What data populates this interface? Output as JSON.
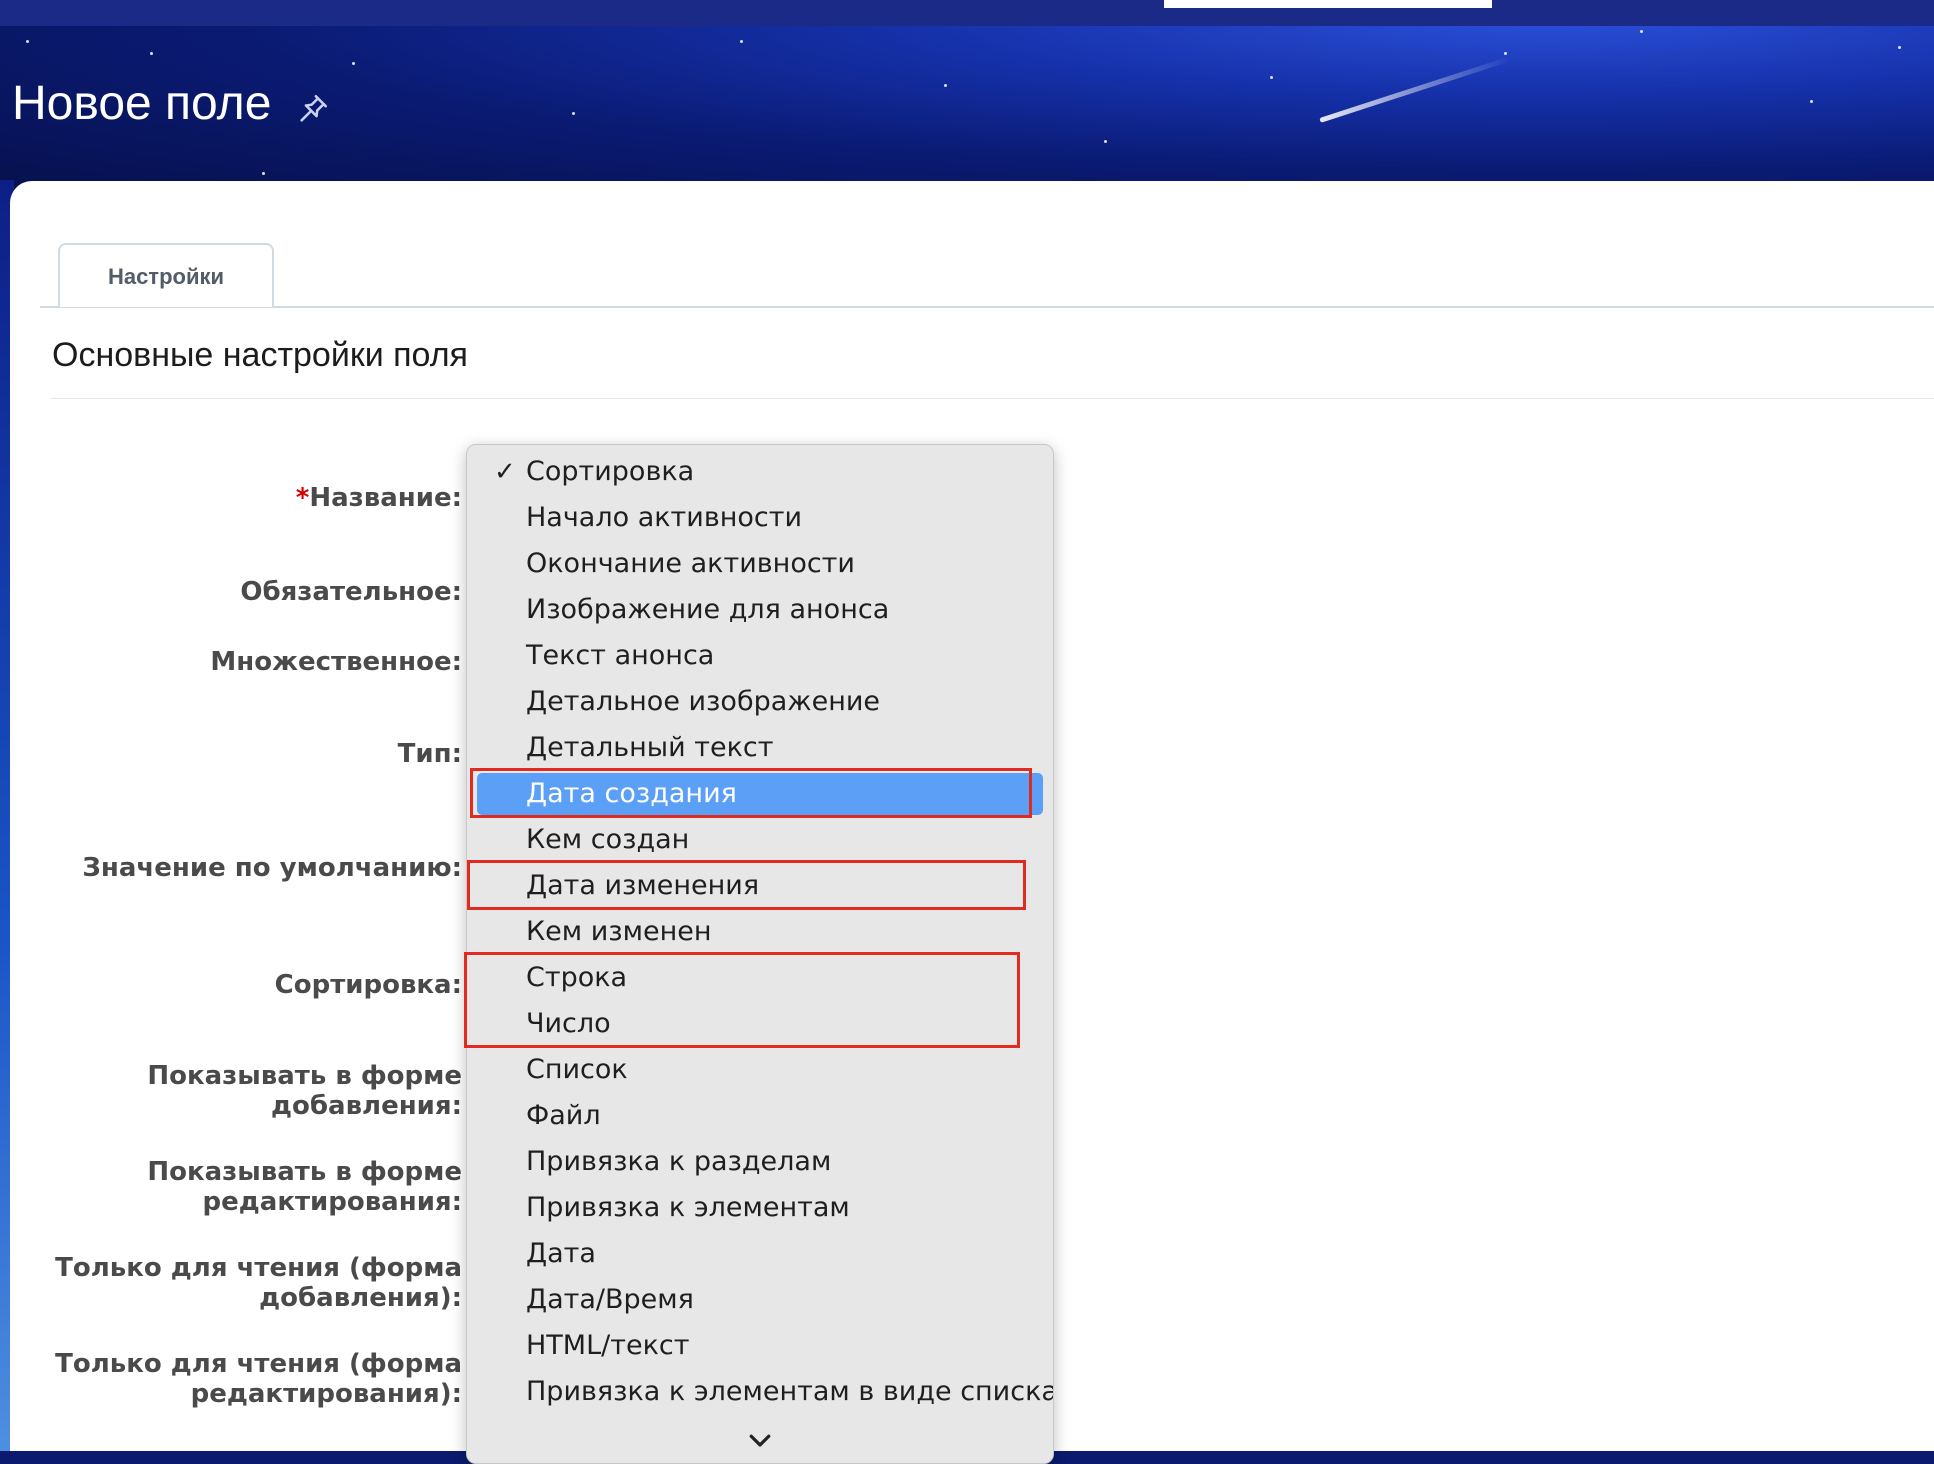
{
  "page": {
    "title": "Новое поле",
    "pin_icon": "pin-icon"
  },
  "tabs": [
    {
      "label": "Настройки",
      "active": true
    }
  ],
  "section": {
    "title": "Основные настройки поля"
  },
  "form": {
    "required_marker": "*",
    "labels": {
      "name": "Название:",
      "required": "Обязательное:",
      "multiple": "Множественное:",
      "type": "Тип:",
      "default_value": "Значение по умолчанию:",
      "sort": "Сортировка:",
      "show_add_1": "Показывать в форме",
      "show_add_2": "добавления:",
      "show_edit_1": "Показывать в форме",
      "show_edit_2": "редактирования:",
      "readonly_add_1": "Только для чтения (форма",
      "readonly_add_2": "добавления):",
      "readonly_edit_1": "Только для чтения (форма",
      "readonly_edit_2": "редактирования):"
    }
  },
  "dropdown": {
    "checkmark": "✓",
    "checked_value": "Сортировка",
    "selected_value": "Дата создания",
    "options": [
      "Сортировка",
      "Начало активности",
      "Окончание активности",
      "Изображение для анонса",
      "Текст анонса",
      "Детальное изображение",
      "Детальный текст",
      "Дата создания",
      "Кем создан",
      "Дата изменения",
      "Кем изменен",
      "Строка",
      "Число",
      "Список",
      "Файл",
      "Привязка к разделам",
      "Привязка к элементам",
      "Дата",
      "Дата/Время",
      "HTML/текст",
      "Привязка к элементам в виде списка"
    ],
    "highlighted_options": [
      "Дата создания",
      "Дата изменения",
      "Строка",
      "Число"
    ],
    "scroll_icon": "chevron-down-icon"
  },
  "colors": {
    "highlight_border": "#e02b20",
    "selected_bg": "#5c9ff7",
    "required_star": "#d40000"
  }
}
